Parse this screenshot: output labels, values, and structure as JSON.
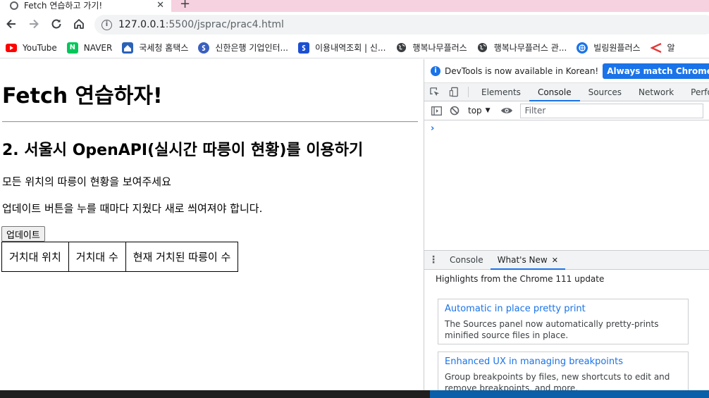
{
  "browser": {
    "tab": {
      "title": "Fetch 연습하고 가기!",
      "close_glyph": "✕"
    },
    "new_tab_glyph": "+",
    "address": {
      "host": "127.0.0.1",
      "port_path": ":5500/jsprac/prac4.html"
    },
    "bookmarks": [
      {
        "label": "YouTube",
        "icon": "youtube-icon",
        "color": "#ff0000"
      },
      {
        "label": "NAVER",
        "icon": "naver-icon",
        "color": "#03c75a",
        "letter": "N"
      },
      {
        "label": "국세청 홈택스",
        "icon": "hometax-icon",
        "color": "#2b62b8"
      },
      {
        "label": "신한은행 기업인터...",
        "icon": "shinhan-icon",
        "color": "#3b5fc0"
      },
      {
        "label": "이용내역조회 | 신...",
        "icon": "card-icon",
        "color": "#1c4fd1"
      },
      {
        "label": "행복나무플러스",
        "icon": "globe-icon",
        "color": "#3c4043"
      },
      {
        "label": "행복나무플러스 관...",
        "icon": "globe-icon",
        "color": "#3c4043"
      },
      {
        "label": "빌링원플러스",
        "icon": "billing-icon",
        "color": "#1a73e8"
      },
      {
        "label": "알",
        "icon": "arrow-icon",
        "color": "#e53935"
      }
    ]
  },
  "page": {
    "h1": "Fetch 연습하자!",
    "h2": "2. 서울시 OpenAPI(실시간 따릉이 현황)를 이용하기",
    "p1": "모든 위치의 따릉이 현황을 보여주세요",
    "p2": "업데이트 버튼을 누를 때마다 지웠다 새로 씌여져야 합니다.",
    "update_button": "업데이트",
    "table_headers": [
      "거치대 위치",
      "거치대 수",
      "현재 거치된 따릉이 수"
    ]
  },
  "devtools": {
    "infobar_message": "DevTools is now available in Korean!",
    "infobar_button": "Always match Chrome's language",
    "tabs": [
      "Elements",
      "Console",
      "Sources",
      "Network",
      "Performance"
    ],
    "active_tab": "Console",
    "context": "top",
    "filter_placeholder": "Filter",
    "prompt": "›",
    "drawer_tabs": [
      "Console",
      "What's New"
    ],
    "drawer_close": "✕",
    "highlights": "Highlights from the Chrome 111 update",
    "cards": [
      {
        "title": "Automatic in place pretty print",
        "body": "The Sources panel now automatically pretty-prints minified source files in place."
      },
      {
        "title": "Enhanced UX in managing breakpoints",
        "body": "Group breakpoints by files, new shortcuts to edit and remove breakpoints, and more."
      }
    ]
  }
}
